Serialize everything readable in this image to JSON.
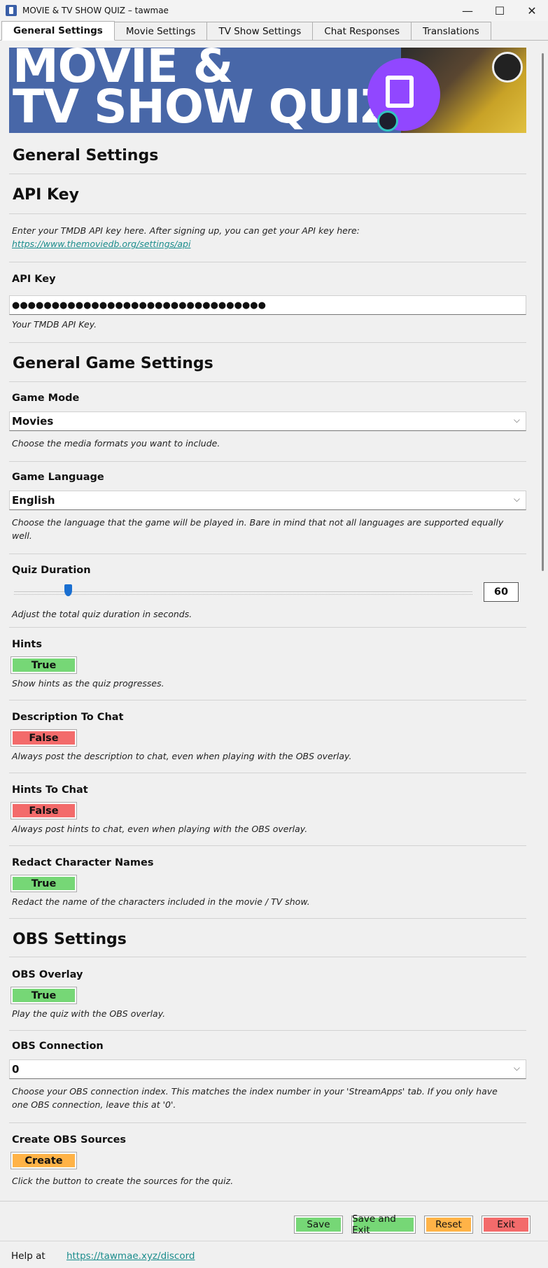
{
  "window": {
    "title": "MOVIE & TV SHOW QUIZ – tawmae",
    "controls": {
      "minimize": "—",
      "maximize": "☐",
      "close": "✕"
    }
  },
  "tabs": [
    "General Settings",
    "Movie Settings",
    "TV Show Settings",
    "Chat Responses",
    "Translations"
  ],
  "banner": {
    "title_line1": "MOVIE &",
    "title_line2": "TV SHOW QUIZ"
  },
  "page_title": "General Settings",
  "api_section": {
    "heading": "API Key",
    "intro": "Enter your TMDB API key here. After signing up, you can get your API key here:",
    "link": "https://www.themoviedb.org/settings/api",
    "field_label": "API Key",
    "masked_value": "●●●●●●●●●●●●●●●●●●●●●●●●●●●●●●●●",
    "help": "Your TMDB API Key."
  },
  "game_section": {
    "heading": "General Game Settings",
    "game_mode": {
      "label": "Game Mode",
      "value": "Movies",
      "help": "Choose the media formats you want to include."
    },
    "game_language": {
      "label": "Game Language",
      "value": "English",
      "help": "Choose the language that the game will be played in. Bare in mind that not all languages are supported equally well."
    },
    "quiz_duration": {
      "label": "Quiz Duration",
      "value": "60",
      "slider_fraction": 0.11,
      "help": "Adjust the total quiz duration in seconds."
    },
    "hints": {
      "label": "Hints",
      "value": "True",
      "help": "Show hints as the quiz progresses."
    },
    "description_to_chat": {
      "label": "Description To Chat",
      "value": "False",
      "help": "Always post the description to chat, even when playing with the OBS overlay."
    },
    "hints_to_chat": {
      "label": "Hints To Chat",
      "value": "False",
      "help": "Always post hints to chat, even when playing with the OBS overlay."
    },
    "redact_names": {
      "label": "Redact Character Names",
      "value": "True",
      "help": "Redact the name of the characters included in the movie / TV show."
    }
  },
  "obs_section": {
    "heading": "OBS Settings",
    "obs_overlay": {
      "label": "OBS Overlay",
      "value": "True",
      "help": "Play the quiz with the OBS overlay."
    },
    "obs_connection": {
      "label": "OBS Connection",
      "value": "0",
      "help": "Choose your OBS connection index. This matches the index number in your 'StreamApps' tab. If you only have one OBS connection, leave this at '0'."
    },
    "create_sources": {
      "label": "Create OBS Sources",
      "button": "Create",
      "help": "Click the button to create the sources for the quiz."
    }
  },
  "footer": {
    "save": "Save",
    "save_exit": "Save and Exit",
    "reset": "Reset",
    "exit": "Exit",
    "help_prefix": "Help at",
    "help_link": "https://tawmae.xyz/discord"
  },
  "colors": {
    "true": "#76d776",
    "false": "#f36b6b",
    "accent": "#ffb347",
    "link": "#1a8c8c",
    "banner": "#4867a8",
    "twitch": "#9147ff"
  },
  "icons": {
    "app": "app-icon",
    "chevron": "chevron-down-icon"
  }
}
